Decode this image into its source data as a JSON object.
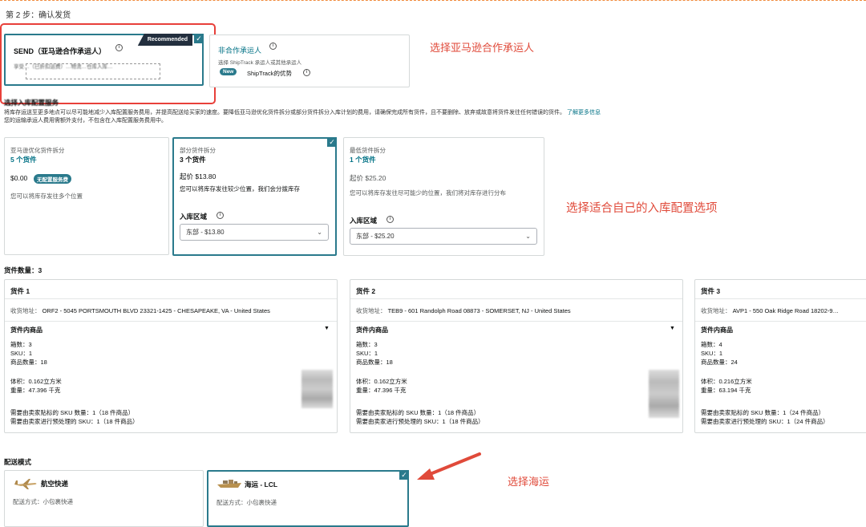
{
  "step_title": "第 2 步：确认发货",
  "carrier": {
    "send": {
      "title": "SEND（亚马逊合作承运人）",
      "recommended": "Recommended",
      "desc": "享受…（已折扣运费）…物流…仓库入库…"
    },
    "non_partner": {
      "title": "非合作承运人",
      "desc": "选择 ShipTrack 承运人或其他承运人",
      "new_badge": "New",
      "shiptrack": "ShipTrack的优势"
    }
  },
  "notes": {
    "carrier": "选择亚马逊合作承运人",
    "inbound": "选择适合自己的入库配置选项",
    "shipping": "选择海运"
  },
  "inbound_service": {
    "title": "选择入库配置服务",
    "desc1": "将库存运送至更多地点可以尽可能地减少入库配置服务费用，并提高配送给买家的速度。要降低亚马逊优化货件拆分或部分货件拆分入库计划的费用，请确保完成所有货件，且不要删除、放弃或故意将货件发往任何错误的货件。",
    "desc1_link": "了解更多信息",
    "desc2": "您的运输承运人费用需额外支付，不包含在入库配置服务费用中。",
    "options": [
      {
        "label": "亚马逊优化货件拆分",
        "count": "5 个货件",
        "price": "$0.00",
        "badge": "无配置服务费",
        "note": "您可以将库存发往多个位置"
      },
      {
        "label": "部分货件拆分",
        "count": "3 个货件",
        "price": "起价 $13.80",
        "note": "您可以将库存发往较少位置，我们会分拨库存",
        "region_label": "入库区域",
        "region_value": "东部 - $13.80"
      },
      {
        "label": "最低货件拆分",
        "count": "1 个货件",
        "price": "起价 $25.20",
        "note": "您可以将库存发往尽可能少的位置，我们将对库存进行分布",
        "region_label": "入库区域",
        "region_value": "东部 - $25.20"
      }
    ]
  },
  "shipments": {
    "count_label": "货件数量：3",
    "items": [
      {
        "title": "货件 1",
        "address_label": "收货地址：",
        "address": "ORF2 - 5045 PORTSMOUTH BLVD 23321-1425 - CHESAPEAKE, VA - United States",
        "products_label": "货件内商品",
        "boxes": "箱数：3",
        "sku": "SKU：1",
        "units": "商品数量：18",
        "volume": "体积：0.162立方米",
        "weight": "重量：47.396 千克",
        "label_sku": "需要由卖家贴标的 SKU 数量：1（18 件商品）",
        "prep_sku": "需要由卖家进行预处理的 SKU：1（18 件商品）"
      },
      {
        "title": "货件 2",
        "address_label": "收货地址：",
        "address": "TEB9 - 601 Randolph Road 08873 - SOMERSET, NJ - United States",
        "products_label": "货件内商品",
        "boxes": "箱数：3",
        "sku": "SKU：1",
        "units": "商品数量：18",
        "volume": "体积：0.162立方米",
        "weight": "重量：47.396 千克",
        "label_sku": "需要由卖家贴标的 SKU 数量：1（18 件商品）",
        "prep_sku": "需要由卖家进行预处理的 SKU：1（18 件商品）"
      },
      {
        "title": "货件 3",
        "address_label": "收货地址：",
        "address": "AVP1 - 550 Oak Ridge Road 18202-9…",
        "products_label": "货件内商品",
        "boxes": "箱数：4",
        "sku": "SKU：1",
        "units": "商品数量：24",
        "volume": "体积：0.216立方米",
        "weight": "重量：63.194 千克",
        "label_sku": "需要由卖家贴标的 SKU 数量：1（24 件商品）",
        "prep_sku": "需要由卖家进行预处理的 SKU：1（24 件商品）"
      }
    ]
  },
  "delivery": {
    "title": "配送模式",
    "options": [
      {
        "name": "航空快递",
        "method": "配送方式：小包裹快递"
      },
      {
        "name": "海运 - LCL",
        "method": "配送方式：小包裹快递"
      }
    ]
  },
  "colors": {
    "accent": "#2a7a8c",
    "annotation": "#e04a3a",
    "link": "#007185"
  }
}
